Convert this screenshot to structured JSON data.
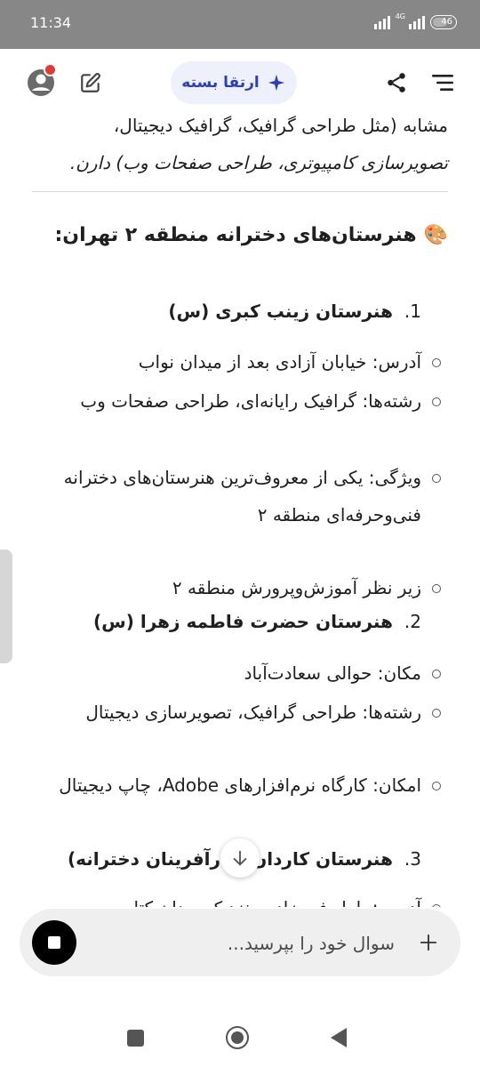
{
  "status_bar": {
    "time": "11:34",
    "network_label": "4G",
    "battery_level": "46"
  },
  "header": {
    "upgrade_label": "ارتقا بسته"
  },
  "content": {
    "intro_lines": [
      "مشابه (مثل طراحی گرافیک، گرافیک دیجیتال،",
      "تصویرسازی کامپیوتری، طراحی صفحات وب) دارن."
    ],
    "heading": "هنرستان‌های دخترانه منطقه ۲ تهران:",
    "schools": [
      {
        "number": "1.",
        "name": "هنرستان زینب کبری (س)",
        "bullets": [
          "آدرس: خیابان آزادی بعد از میدان نواب",
          "رشته‌ها: گرافیک رایانه‌ای، طراحی صفحات وب",
          "ویژگی: یکی از معروف‌ترین هنرستان‌های دخترانه فنی‌وحرفه‌ای منطقه ۲",
          "زیر نظر آموزش‌وپرورش منطقه ۲"
        ]
      },
      {
        "number": "2.",
        "name": "هنرستان حضرت فاطمه زهرا (س)",
        "bullets": [
          "مکان: حوالی سعادت‌آباد",
          "رشته‌ها: طراحی گرافیک، تصویرسازی دیجیتال",
          "امکان: کارگاه نرم‌افزارهای Adobe، چاپ دیجیتال"
        ]
      },
      {
        "number": "3.",
        "name": "هنرستان کاردان (کارآفرینان دخترانه)",
        "bullets": [
          "آدرس: بلوار فرحزادی، نزدیک میدان کتاب"
        ]
      }
    ]
  },
  "input": {
    "placeholder": "سوال خود را بپرسید..."
  },
  "colors": {
    "accent": "#2d3fb5",
    "status_bar": "#878787",
    "notification_dot": "#e53935"
  }
}
